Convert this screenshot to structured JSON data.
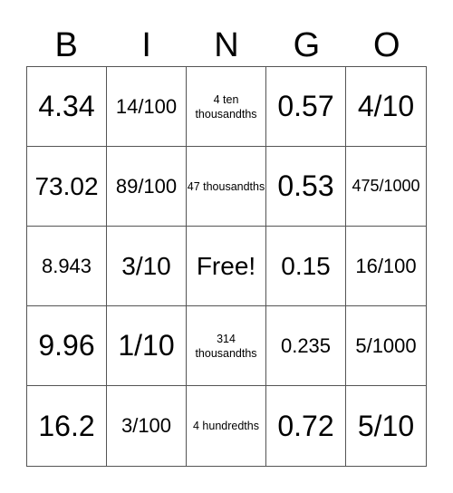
{
  "header": [
    "B",
    "I",
    "N",
    "G",
    "O"
  ],
  "cells": [
    {
      "text": "4.34",
      "size": "s-xl"
    },
    {
      "text": "14/100",
      "size": "s-m"
    },
    {
      "text": "4 ten thousandths",
      "size": "s-xs"
    },
    {
      "text": "0.57",
      "size": "s-xl"
    },
    {
      "text": "4/10",
      "size": "s-xl"
    },
    {
      "text": "73.02",
      "size": "s-l"
    },
    {
      "text": "89/100",
      "size": "s-m"
    },
    {
      "text": "47 thousandths",
      "size": "s-xs"
    },
    {
      "text": "0.53",
      "size": "s-xl"
    },
    {
      "text": "475/1000",
      "size": "s-s"
    },
    {
      "text": "8.943",
      "size": "s-m"
    },
    {
      "text": "3/10",
      "size": "s-l"
    },
    {
      "text": "Free!",
      "size": "s-l"
    },
    {
      "text": "0.15",
      "size": "s-l"
    },
    {
      "text": "16/100",
      "size": "s-m"
    },
    {
      "text": "9.96",
      "size": "s-xl"
    },
    {
      "text": "1/10",
      "size": "s-xl"
    },
    {
      "text": "314 thousandths",
      "size": "s-xs"
    },
    {
      "text": "0.235",
      "size": "s-m"
    },
    {
      "text": "5/1000",
      "size": "s-m"
    },
    {
      "text": "16.2",
      "size": "s-xl"
    },
    {
      "text": "3/100",
      "size": "s-m"
    },
    {
      "text": "4 hundredths",
      "size": "s-xs"
    },
    {
      "text": "0.72",
      "size": "s-xl"
    },
    {
      "text": "5/10",
      "size": "s-xl"
    }
  ]
}
